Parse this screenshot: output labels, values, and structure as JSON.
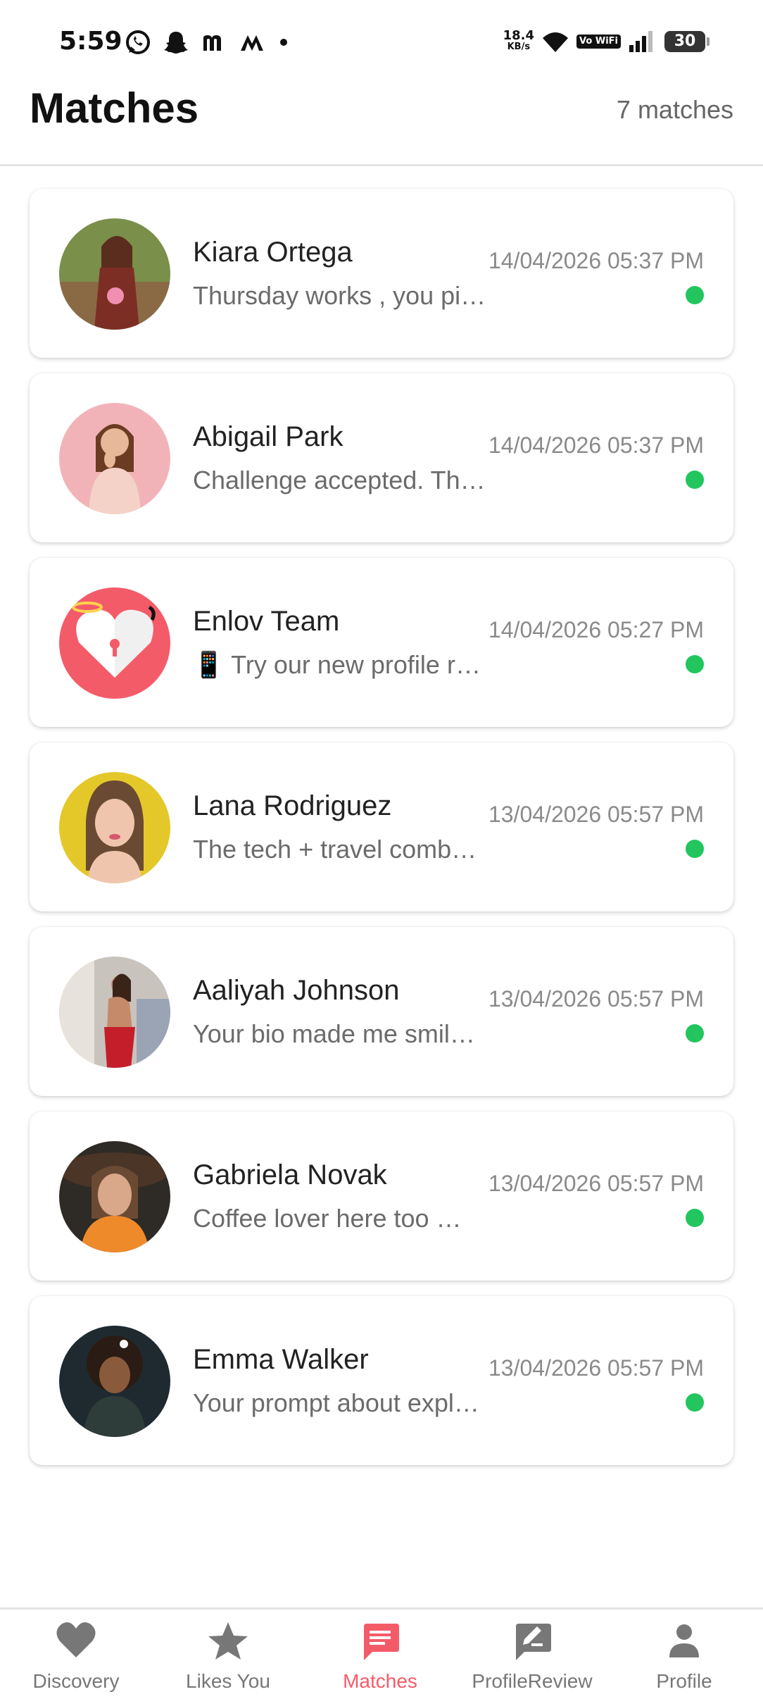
{
  "status_bar": {
    "time": "5:59",
    "net_speed": "18.4",
    "net_unit": "KB/s",
    "vowifi": "Vo WiFi",
    "battery": "30",
    "icons": [
      "whatsapp-icon",
      "snapchat-icon",
      "m-app-icon",
      "m-app-icon-2",
      "wifi-icon",
      "signal-icon"
    ]
  },
  "header": {
    "title": "Matches",
    "count": "7 matches"
  },
  "matches": [
    {
      "name": "Kiara Ortega",
      "preview": "Thursday works , you pi…",
      "time": "14/04/2026 05:37 PM"
    },
    {
      "name": "Abigail Park",
      "preview": "Challenge accepted. Th…",
      "time": "14/04/2026 05:37 PM"
    },
    {
      "name": "Enlov Team",
      "preview": "📱 Try our new profile r…",
      "time": "14/04/2026 05:27 PM"
    },
    {
      "name": "Lana Rodriguez",
      "preview": "The tech + travel comb…",
      "time": "13/04/2026 05:57 PM"
    },
    {
      "name": "Aaliyah Johnson",
      "preview": "Your bio made me smil…",
      "time": "13/04/2026 05:57 PM"
    },
    {
      "name": "Gabriela Novak",
      "preview": "Coffee lover here too …",
      "time": "13/04/2026 05:57 PM"
    },
    {
      "name": "Emma Walker",
      "preview": "Your prompt about expl…",
      "time": "13/04/2026 05:57 PM"
    }
  ],
  "nav": {
    "items": [
      {
        "label": "Discovery",
        "icon": "heart-icon"
      },
      {
        "label": "Likes You",
        "icon": "star-icon"
      },
      {
        "label": "Matches",
        "icon": "chat-icon",
        "active": true
      },
      {
        "label": "ProfileReview",
        "icon": "edit-icon"
      },
      {
        "label": "Profile",
        "icon": "person-icon"
      }
    ]
  },
  "colors": {
    "accent": "#f45b69",
    "online": "#22c55e",
    "inactive_nav": "#777777"
  }
}
